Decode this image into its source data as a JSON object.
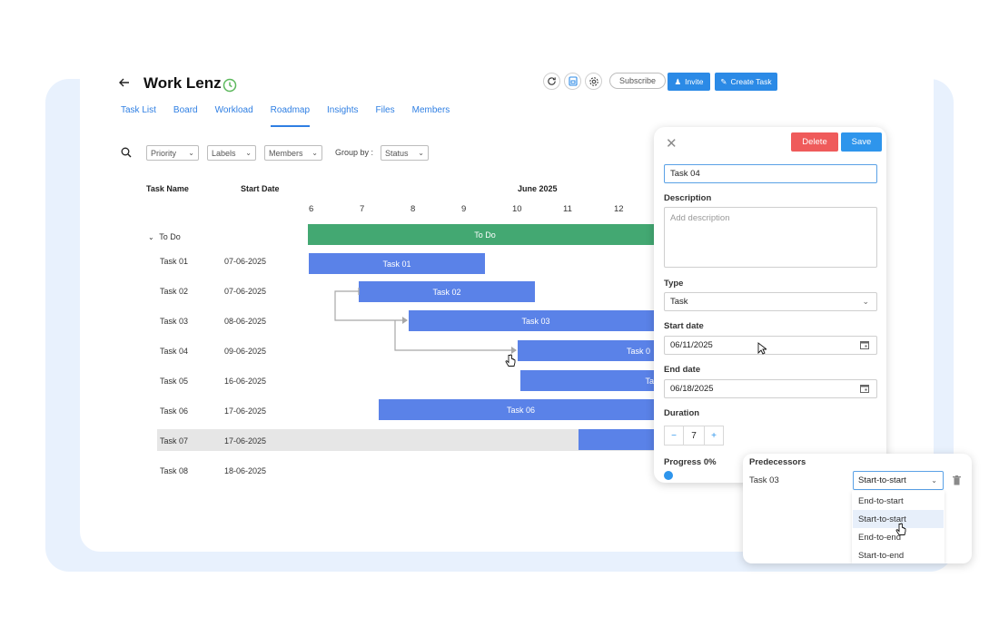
{
  "project": {
    "title": "Work Lenz",
    "back_icon": "arrow-left-icon",
    "status_icon": "clock-icon",
    "status_color": "#5cb85c"
  },
  "toolbar": {
    "subscribe_label": "Subscribe",
    "invite_label": "Invite",
    "create_task_label": "Create Task"
  },
  "tabs": [
    {
      "label": "Task List"
    },
    {
      "label": "Board"
    },
    {
      "label": "Workload"
    },
    {
      "label": "Roadmap",
      "active": true
    },
    {
      "label": "Insights"
    },
    {
      "label": "Files"
    },
    {
      "label": "Members"
    }
  ],
  "filters": {
    "priority": "Priority",
    "labels": "Labels",
    "members": "Members",
    "group_by_label": "Group by :",
    "group_by_value": "Status"
  },
  "gantt": {
    "col_task_name": "Task Name",
    "col_start_date": "Start Date",
    "month": "June 2025",
    "days": [
      "6",
      "7",
      "8",
      "9",
      "10",
      "11",
      "12"
    ],
    "group": {
      "label": "To Do",
      "bar_label": "To Do",
      "color": "#43a872"
    },
    "bar_color": "#5a82e8",
    "rows": [
      {
        "name": "Task 01",
        "date": "07-06-2025",
        "bar": "Task 01"
      },
      {
        "name": "Task 02",
        "date": "07-06-2025",
        "bar": "Task 02"
      },
      {
        "name": "Task 03",
        "date": "08-06-2025",
        "bar": "Task 03"
      },
      {
        "name": "Task 04",
        "date": "09-06-2025",
        "bar": "Task 0"
      },
      {
        "name": "Task 05",
        "date": "16-06-2025",
        "bar": "Ta"
      },
      {
        "name": "Task 06",
        "date": "17-06-2025",
        "bar": "Task 06"
      },
      {
        "name": "Task 07",
        "date": "17-06-2025",
        "bar": ""
      },
      {
        "name": "Task 08",
        "date": "18-06-2025",
        "bar": ""
      }
    ]
  },
  "panel": {
    "delete_label": "Delete",
    "save_label": "Save",
    "task_name": "Task 04",
    "description_label": "Description",
    "description_placeholder": "Add description",
    "type_label": "Type",
    "type_value": "Task",
    "start_label": "Start date",
    "start_value": "06/11/2025",
    "end_label": "End date",
    "end_value": "06/18/2025",
    "duration_label": "Duration",
    "duration_value": "7",
    "progress_label": "Progress 0%",
    "progress": 0
  },
  "predecessors": {
    "title": "Predecessors",
    "task": "Task 03",
    "selected": "Start-to-start",
    "options": [
      "End-to-start",
      "Start-to-start",
      "End-to-end",
      "Start-to-end"
    ]
  },
  "colors": {
    "accent": "#2b8ae6",
    "delete": "#ef5b5b",
    "save": "#2e95ec"
  }
}
